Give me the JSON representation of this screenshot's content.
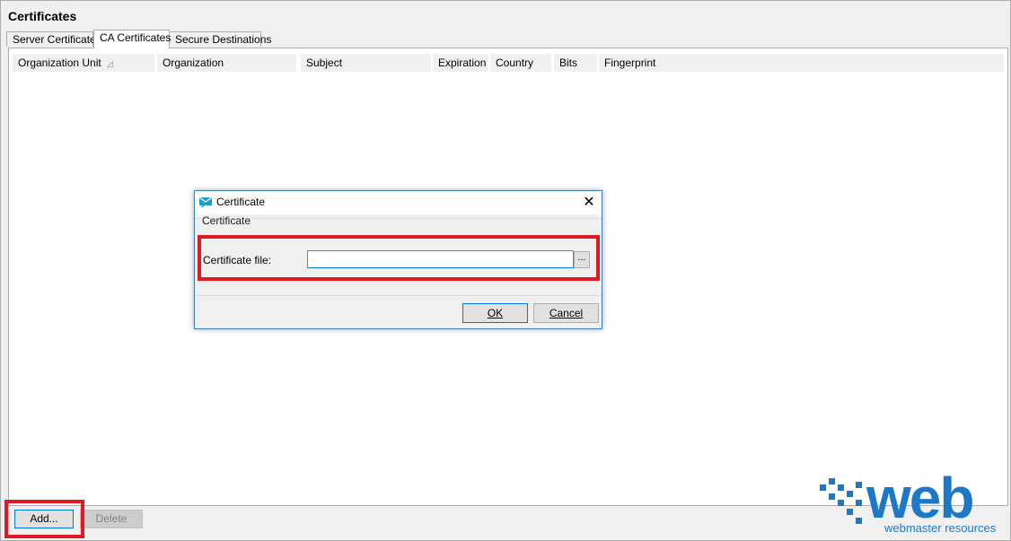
{
  "window": {
    "title": "Certificates"
  },
  "tabs": [
    {
      "label": "Server Certificates",
      "active": false
    },
    {
      "label": "CA Certificates",
      "active": true
    },
    {
      "label": "Secure Destinations",
      "active": false
    }
  ],
  "table": {
    "columns": [
      "Organization Unit",
      "Organization",
      "Subject",
      "Expiration",
      "Country",
      "Bits",
      "Fingerprint"
    ],
    "sort_column": "Organization Unit",
    "rows": []
  },
  "buttons": {
    "add": "Add...",
    "delete": "Delete"
  },
  "dialog": {
    "title": "Certificate",
    "group_label": "Certificate",
    "field_label": "Certificate file:",
    "field_value": "",
    "browse": "...",
    "ok": "OK",
    "cancel": "Cancel"
  },
  "watermark": {
    "logo": "web",
    "tagline": "webmaster resources"
  },
  "colors": {
    "highlight": "#e01a22",
    "accent": "#0078d7",
    "logo_blue": "#1e78c8",
    "logo_orange": "#e8452d"
  },
  "icons": {
    "dialog": "certificate-envelope-icon",
    "close": "close-icon",
    "sort": "sort-ascending-icon"
  }
}
